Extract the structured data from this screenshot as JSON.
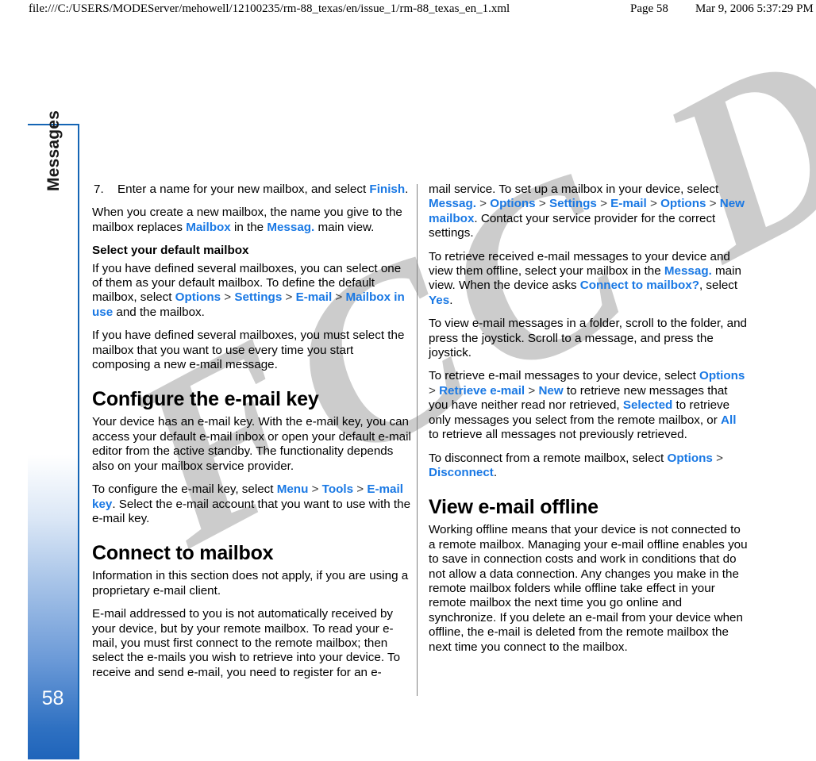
{
  "print_header": {
    "url": "file:///C:/USERS/MODEServer/mehowell/12100235/rm-88_texas/en/issue_1/rm-88_texas_en_1.xml",
    "page": "Page 58",
    "date": "Mar 9, 2006 5:37:29 PM"
  },
  "watermark": {
    "text": "FCC DRAFT",
    "color": "#cccccc"
  },
  "rail": {
    "chapter": "Messages",
    "page_number": "58",
    "accent_color": "#1565b5",
    "gradient_bottom_color": "#1f64ba"
  },
  "theme": {
    "ui_term_color": "#1978e4",
    "body_text_color": "#000000",
    "divider_color": "#808080"
  },
  "left_column": {
    "step": {
      "number": "7.",
      "text_before": "Enter a name for your new mailbox, and select ",
      "ui": "Finish",
      "text_after": "."
    },
    "para_1": {
      "a": "When you create a new mailbox, the name you give to the mailbox replaces ",
      "ui1": "Mailbox",
      "b": " in the ",
      "ui2": "Messag.",
      "c": " main view."
    },
    "subheading": "Select your default mailbox",
    "para_2": {
      "a": "If you have defined several mailboxes, you can select one of them as your default mailbox. To define the default mailbox, select ",
      "ui1": "Options",
      "ui2": "Settings",
      "ui3": "E-mail",
      "ui4": "Mailbox in use",
      "b": " and the mailbox."
    },
    "para_3": "If you have defined several mailboxes, you must select the mailbox that you want to use every time you start composing a new e-mail message.",
    "heading_1": "Configure the e-mail key",
    "para_4": "Your device has an e-mail key. With the e-mail key, you can access your default e-mail inbox or open your default e-mail editor from the active standby. The functionality depends also on your mailbox service provider.",
    "para_5": {
      "a": "To configure the e-mail key, select ",
      "ui1": "Menu",
      "ui2": "Tools",
      "ui3": "E-mail key",
      "b": ". Select the e-mail account that you want to use with the e-mail key."
    },
    "heading_2": "Connect to mailbox",
    "para_6": "Information in this section does not apply, if you are using a proprietary e-mail client.",
    "para_7": "E-mail addressed to you is not automatically received by your device, but by your remote mailbox. To read your e-mail, you must first connect to the remote mailbox; then select the e-mails you wish to retrieve into your device. To receive and send e-mail, you need to register for an e-"
  },
  "right_column": {
    "para_1": {
      "a": "mail service. To set up a mailbox in your device, select ",
      "ui1": "Messag.",
      "ui2": "Options",
      "ui3": "Settings",
      "ui4": "E-mail",
      "ui5": "Options",
      "ui6": "New mailbox",
      "b": ". Contact your service provider for the correct settings."
    },
    "para_2": {
      "a": "To retrieve received e-mail messages to your device and view them offline, select your mailbox in the ",
      "ui1": "Messag.",
      "b": " main view. When the device asks ",
      "ui2": "Connect to mailbox?",
      "c": ", select ",
      "ui3": "Yes",
      "d": "."
    },
    "para_3": "To view e-mail messages in a folder, scroll to the folder, and press the joystick. Scroll to a message, and press the joystick.",
    "para_4": {
      "a": "To retrieve e-mail messages to your device, select ",
      "ui1": "Options",
      "ui2": "Retrieve e-mail",
      "ui3": "New",
      "b": " to retrieve new messages that you have neither read nor retrieved, ",
      "ui4": "Selected",
      "c": " to retrieve only messages you select from the remote mailbox, or ",
      "ui5": "All",
      "d": " to retrieve all messages not previously retrieved."
    },
    "para_5": {
      "a": "To disconnect from a remote mailbox, select ",
      "ui1": "Options",
      "ui2": "Disconnect",
      "b": "."
    },
    "heading_1": "View e-mail offline",
    "para_6": "Working offline means that your device is not connected to a remote mailbox. Managing your e-mail offline enables you to save in connection costs and work in conditions that do not allow a data connection. Any changes you make in the remote mailbox folders while offline take effect in your remote mailbox the next time you go online and synchronize. If you delete an e-mail from your device when offline, the e-mail is deleted from the remote mailbox the next time you connect to the mailbox."
  },
  "separators": {
    "gt": " > "
  }
}
